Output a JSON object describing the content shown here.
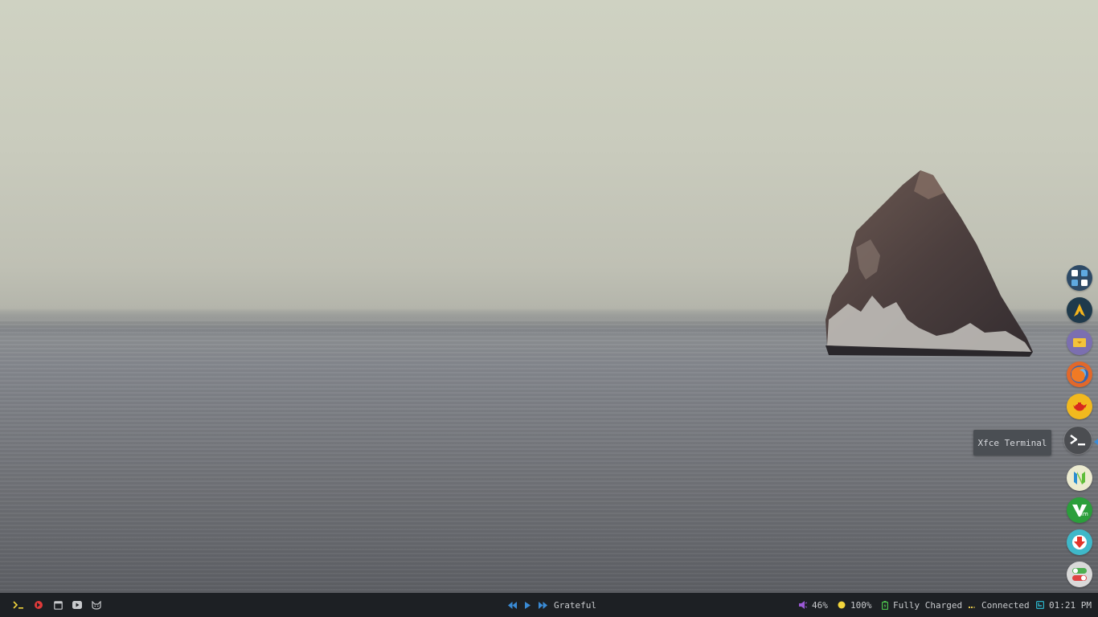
{
  "desktop": {
    "wallpaper": "sea-rock-fog"
  },
  "dock": {
    "items": [
      {
        "name": "app-launcher",
        "icon": "grid-squares-icon",
        "color": "#2e4a66"
      },
      {
        "name": "arch-linux",
        "icon": "arch-logo-icon",
        "color": "#1f3a4c"
      },
      {
        "name": "file-manager",
        "icon": "folder-icon",
        "color": "#7b6fb0"
      },
      {
        "name": "firefox",
        "icon": "firefox-icon",
        "color": "#e2682a"
      },
      {
        "name": "teapot-app",
        "icon": "teapot-icon",
        "color": "#f2b91e"
      },
      {
        "name": "xfce-terminal",
        "icon": "terminal-prompt-icon",
        "color": "#4b4d51",
        "active": true
      },
      {
        "name": "neovim",
        "icon": "neovim-icon",
        "color": "#ecebd0"
      },
      {
        "name": "vim",
        "icon": "vim-icon",
        "color": "#2b9e3b"
      },
      {
        "name": "downloader",
        "icon": "download-arrow-icon",
        "color": "#3fb8c9"
      },
      {
        "name": "settings-toggles",
        "icon": "toggle-switch-icon",
        "color": "#d9d9d9"
      }
    ],
    "tooltip": "Xfce Terminal"
  },
  "panel": {
    "left_icons": [
      "terminal-icon",
      "app-red-icon",
      "window-icon",
      "youtube-icon",
      "cat-icon"
    ],
    "media": {
      "track": "Grateful"
    },
    "volume": "46%",
    "brightness": "100%",
    "battery": "Fully Charged",
    "network": "Connected",
    "clock": "01:21 PM"
  },
  "colors": {
    "panel_bg": "#1d2024",
    "accent_blue": "#3a8bd6",
    "volume_purple": "#9b59d6",
    "brightness_yellow": "#f3d53c",
    "battery_green": "#4cc24c",
    "network_yellow": "#e6c84a",
    "clock_cyan": "#2cb3c9"
  }
}
